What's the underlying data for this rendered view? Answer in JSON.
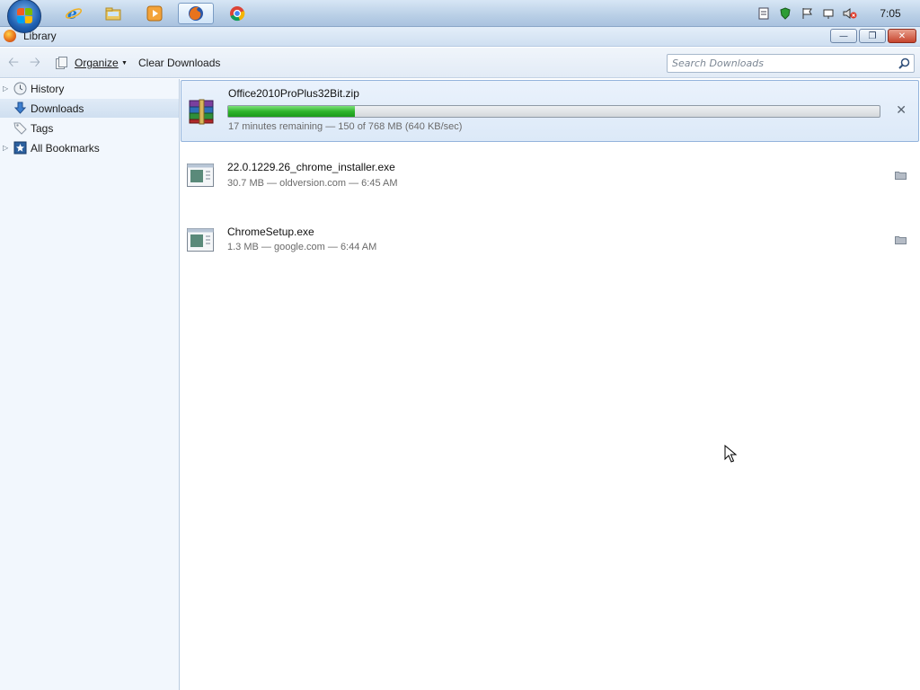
{
  "taskbar": {
    "apps": [
      {
        "name": "internet-explorer-icon"
      },
      {
        "name": "file-explorer-icon"
      },
      {
        "name": "media-player-icon"
      },
      {
        "name": "firefox-icon"
      },
      {
        "name": "chrome-icon"
      }
    ],
    "active_app": "firefox",
    "clock": "7:05"
  },
  "window": {
    "title": "Library",
    "buttons": {
      "minimize": "—",
      "restore": "❐",
      "close": "✕"
    }
  },
  "toolbar": {
    "organize_label": "Organize",
    "clear_label": "Clear Downloads",
    "search_placeholder": "Search Downloads"
  },
  "sidebar": {
    "items": [
      {
        "label": "History",
        "icon": "clock-icon",
        "expandable": true,
        "selected": false
      },
      {
        "label": "Downloads",
        "icon": "download-arrow-icon",
        "expandable": false,
        "selected": true
      },
      {
        "label": "Tags",
        "icon": "tag-icon",
        "expandable": false,
        "selected": false
      },
      {
        "label": "All Bookmarks",
        "icon": "bookmark-star-icon",
        "expandable": true,
        "selected": false
      }
    ]
  },
  "downloads": [
    {
      "filename": "Office2010ProPlus32Bit.zip",
      "status": "17 minutes remaining — 150 of 768 MB (640 KB/sec)",
      "in_progress": true,
      "progress": 0.195,
      "icon": "winrar-archive-icon"
    },
    {
      "filename": "22.0.1229.26_chrome_installer.exe",
      "status": "30.7 MB — oldversion.com — 6:45 AM",
      "in_progress": false,
      "icon": "executable-icon"
    },
    {
      "filename": "ChromeSetup.exe",
      "status": "1.3 MB — google.com — 6:44 AM",
      "in_progress": false,
      "icon": "executable-icon"
    }
  ],
  "colors": {
    "progress_green": "#2fb42c",
    "selection_blue": "#dce9f8"
  }
}
